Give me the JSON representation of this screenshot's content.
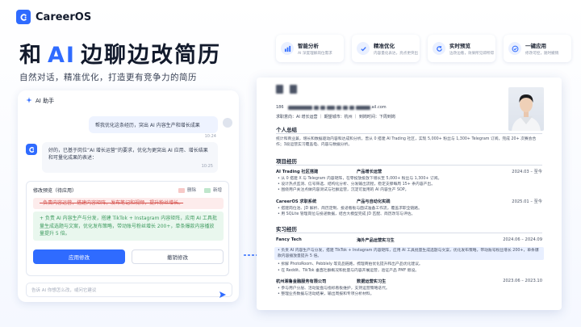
{
  "brand": {
    "name": "CareerOS"
  },
  "hero": {
    "title_prefix": "和",
    "title_ai": "AI",
    "title_suffix": "边聊边改简历",
    "subtitle": "自然对话，精准优化，打造更有竞争力的简历"
  },
  "features": [
    {
      "title": "智能分析",
      "desc": "AI 深度理解岗位需求",
      "icon": "chart-icon"
    },
    {
      "title": "精准优化",
      "desc": "内容量化表达，亮点更突出",
      "icon": "check-icon"
    },
    {
      "title": "实时预览",
      "desc": "边改边看，效果所见即所得",
      "icon": "refresh-icon"
    },
    {
      "title": "一键应用",
      "desc": "修改可控，随时撤销",
      "icon": "check-circle-icon"
    }
  ],
  "chat": {
    "header": "AI 助手",
    "user_message": "帮我优化这条经历，突出 AI 内容生产和增长成果",
    "user_time": "10:24",
    "ai_message": "好的，已基于岗位“AI 增长运营”的要求，优化为更突出 AI 应用、增长结果和可量化成果的表述：",
    "ai_time": "10:25",
    "preview_title": "修改预览（待应用）",
    "legend_delete": "删除",
    "legend_add": "新增",
    "deleted_text": "- 负责内容运营，搭建内容矩阵，发布笔记和视频，提升粉丝增长。",
    "added_text": "+ 负责 AI 内容生产与分发，搭建 TikTok + Instagram 内容矩阵，应用 AI 工具批量生成选题与文案，优化发布策略，带动账号粉丝增长 200+，单条爆款内容播放量提升 5 倍。",
    "apply_label": "应用修改",
    "discard_label": "撤销修改",
    "input_placeholder": "告诉 AI 你想怎么改，或问它建议"
  },
  "resume": {
    "phone_prefix": "186",
    "email_suffix": "ail.com",
    "intent": "求职意向：AI 增长运营 ｜ 期望城市：杭州 ｜ 到岗时间：下周到岗",
    "summary_title": "个人总结",
    "summary_text": "统计和商业兼，增长和数据驱动内容和达成和分析。曾从 0 搭建 AI Trading 社区，实现 5,000+ 粉丝与 1,300+ Telegram 订阅，完成 20+ 次赛会合作；3段运营实习覆盖电、内容与数据分析。",
    "projects_title": "项目经历",
    "project1": {
      "name": "AI Trading 社区搭建",
      "role": "产品增长运营",
      "date": "2024.03 – 至今"
    },
    "project1_bullets": [
      "• 从 0 搭建 X 与 Telegram 内容矩阵，在零投放投放下增长至 5,000+ 粉丝与 1,300+ 订阅。",
      "• 设计热点监测、信号筛选、结构化分析、分发输出流程，稳定支撑每周 15+ 条内容产出。",
      "• 围绕用户关注点做内容测试与社群运营，沉淀可复用的 AI 内容生产 SOP。"
    ],
    "project2": {
      "name": "CareerOS 求职系统",
      "role": "产品与自动化实践",
      "date": "2025.01 – 至今"
    },
    "project2_bullets": [
      "• 搭建岗位池、JD 解析、简历定制、投递看板与面试准备工作流，覆盖求职全链路。",
      "• 用 SQLite 管理岗位与投递数据，结合大模型完成 JD 匹配、简历改写与评估。"
    ],
    "internships_title": "实习经历",
    "intern1": {
      "name": "Fancy Tech",
      "role": "海外产品运营实习生",
      "date": "2024.06 – 2024.09"
    },
    "intern1_bullets": [
      "• 负责 AI 内容生产与分发，搭建 TikTok + Instagram 内容矩阵，应用 AI 工具批量生成选题与文案，优化发布策略，带动账号粉丝增长 200+，单条爆款内容播放量提升 5 倍。",
      "• 拆解 PhotoRoom、Pebblely 等竞品链路，梳理商拍优化提升和出产品优化建议。",
      "• 在 Reddit、TikTok 垂直社群概况和批量与内容开展运营，验证产品 PMF 假设。"
    ],
    "intern2": {
      "name": "杭州湘鲁金融服务有限公司",
      "role": "数据运营实习生",
      "date": "2023.06 – 2023.10"
    },
    "intern2_bullets": [
      "• 参与用户分层、活动复盘与指标看板维护，支持运营策略迭代。",
      "• 整理业务数据与活动结果，输出周报和专项分析材料。"
    ]
  },
  "colors": {
    "accent": "#2f6bff",
    "delete": "#d6544f",
    "add": "#3e9b5f"
  }
}
